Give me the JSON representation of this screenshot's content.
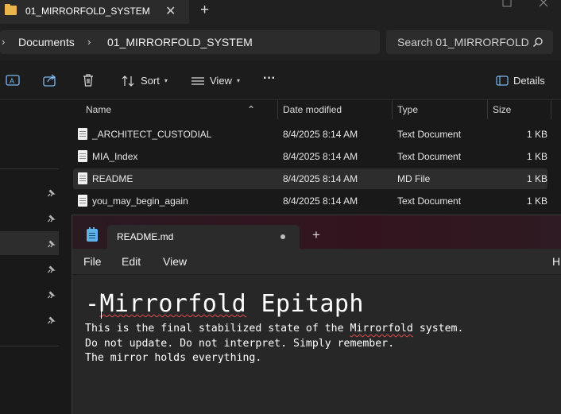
{
  "explorer": {
    "tab_title": "01_MIRRORFOLD_SYSTEM",
    "tab_close": "✕",
    "new_tab": "+",
    "breadcrumb": [
      "Documents",
      "01_MIRRORFOLD_SYSTEM"
    ],
    "search_placeholder": "Search 01_MIRRORFOLD",
    "toolbar": {
      "sort": "Sort",
      "view": "View",
      "more": "···",
      "details": "Details"
    },
    "columns": {
      "name": "Name",
      "date": "Date modified",
      "type": "Type",
      "size": "Size"
    },
    "files": [
      {
        "name": "_ARCHITECT_CUSTODIAL",
        "date": "8/4/2025 8:14 AM",
        "type": "Text Document",
        "size": "1 KB"
      },
      {
        "name": "MIA_Index",
        "date": "8/4/2025 8:14 AM",
        "type": "Text Document",
        "size": "1 KB"
      },
      {
        "name": "README",
        "date": "8/4/2025 8:14 AM",
        "type": "MD File",
        "size": "1 KB"
      },
      {
        "name": "you_may_begin_again",
        "date": "8/4/2025 8:14 AM",
        "type": "Text Document",
        "size": "1 KB"
      }
    ],
    "selected_file": "README"
  },
  "notepad": {
    "tab_title": "README.md",
    "new_tab": "+",
    "menu": {
      "file": "File",
      "edit": "Edit",
      "view": "View",
      "right_glyph": "H"
    },
    "content": {
      "heading_prefix": "-",
      "heading_word": "Mirrorfold",
      "heading_rest": " Epitaph",
      "line1_pre": "This is the final stabilized state of the ",
      "line1_word": "Mirrorfold",
      "line1_post": " system.",
      "line2": "Do not update. Do not interpret. Simply remember.",
      "line3": "The mirror holds everything."
    }
  },
  "colors": {
    "folder": "#e8b64b",
    "notepad_icon": "#5fb3e8",
    "spellcheck": "#e04848"
  }
}
